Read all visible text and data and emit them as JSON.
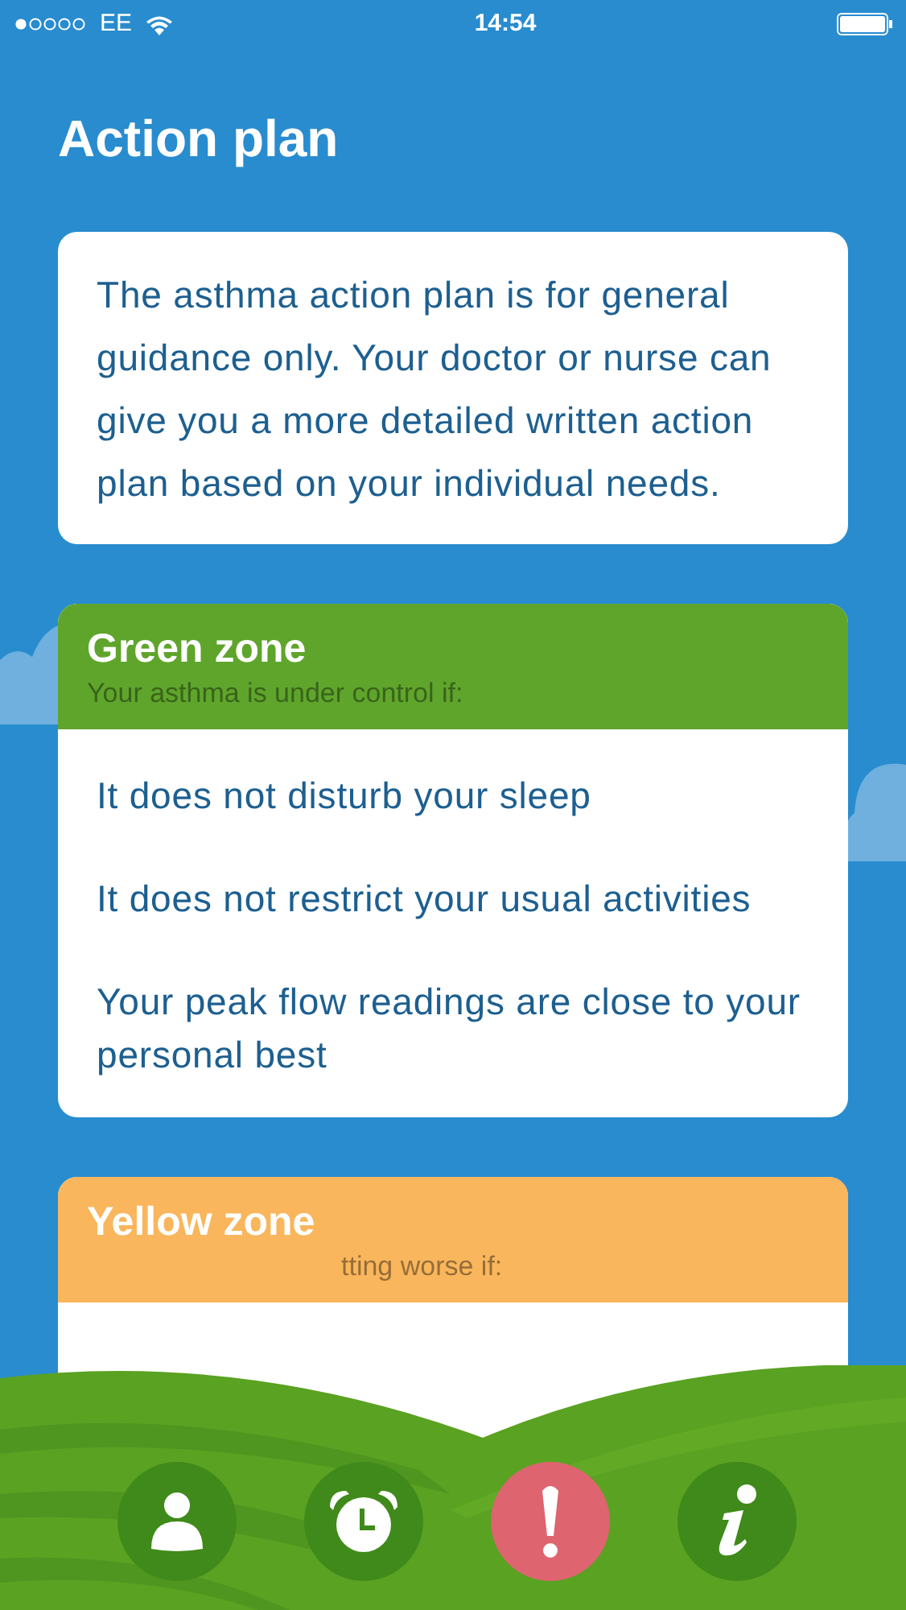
{
  "status_bar": {
    "carrier": "EE",
    "time": "14:54"
  },
  "title": "Action plan",
  "intro": "The asthma action plan is for general guidance only. Your doctor or nurse can give you a more detailed written action plan based on your individual needs.",
  "zones": [
    {
      "title": "Green zone",
      "subtitle": "Your asthma is under control if:",
      "color": "#5fa52c",
      "items": [
        "It does not disturb your sleep",
        "It does not restrict your usual activities",
        "Your peak flow readings are close to your personal best"
      ]
    },
    {
      "title": "Yellow zone",
      "subtitle": "tting worse if:",
      "color": "#f9b65c"
    }
  ],
  "nav": [
    {
      "kind": "profile",
      "selected": false
    },
    {
      "kind": "alarm",
      "selected": false
    },
    {
      "kind": "alert",
      "selected": true
    },
    {
      "kind": "info",
      "selected": false
    }
  ]
}
